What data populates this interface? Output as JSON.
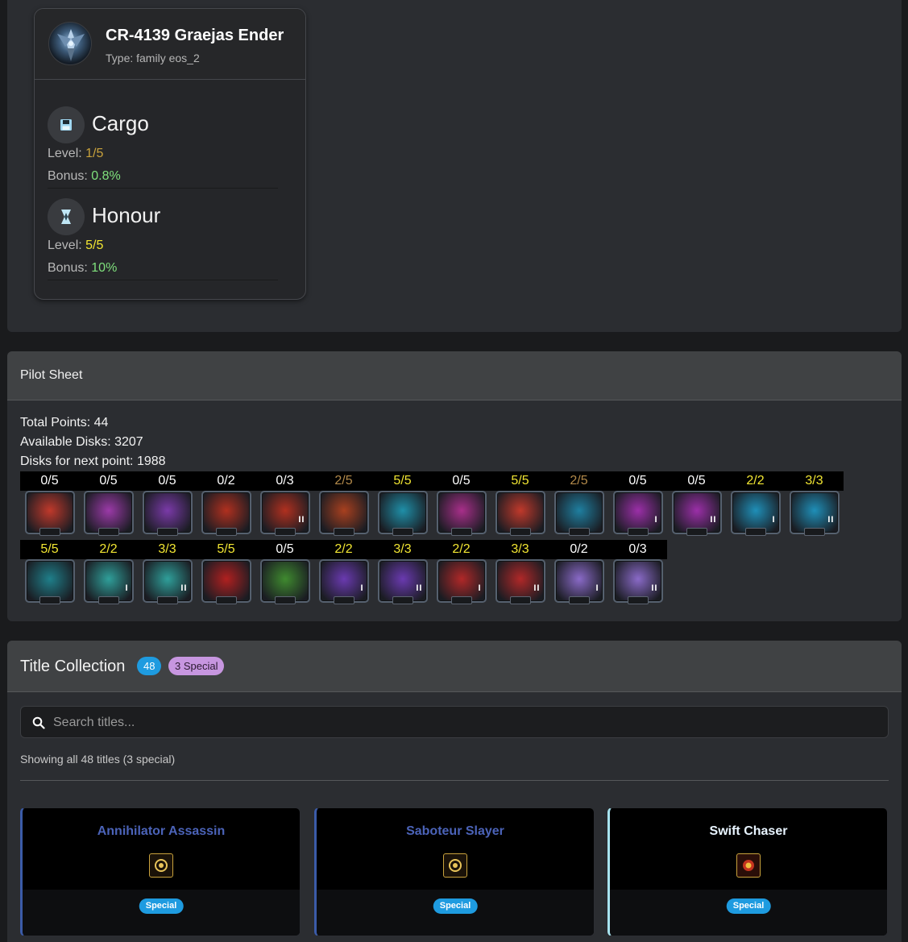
{
  "pet": {
    "name": "CR-4139 Graejas Ender",
    "type": "Type: family eos_2",
    "gears": [
      {
        "name": "Cargo",
        "level_label": "Level:",
        "level": "1/5",
        "bonus_label": "Bonus:",
        "bonus": "0.8%",
        "icon": "floppy-disk-icon"
      },
      {
        "name": "Honour",
        "level_label": "Level:",
        "level": "5/5",
        "bonus_label": "Bonus:",
        "bonus": "10%",
        "icon": "honour-badge-icon"
      }
    ]
  },
  "pilot_sheet": {
    "title": "Pilot Sheet",
    "total_points": "Total Points: 44",
    "available_disks": "Available Disks: 3207",
    "disks_next": "Disks for next point: 1988",
    "row1": [
      {
        "count": "0/5",
        "color": "#c0392b",
        "tier": ""
      },
      {
        "count": "0/5",
        "color": "#9b3aa8",
        "tier": ""
      },
      {
        "count": "0/5",
        "color": "#7a3aa8",
        "tier": ""
      },
      {
        "count": "0/2",
        "color": "#b0301f",
        "tier": ""
      },
      {
        "count": "0/3",
        "color": "#b0301f",
        "tier": "II"
      },
      {
        "count": "2/5",
        "color": "#a8401f",
        "tier": ""
      },
      {
        "count": "5/5",
        "color": "#1f8fa8",
        "tier": ""
      },
      {
        "count": "0/5",
        "color": "#a82f8a",
        "tier": ""
      },
      {
        "count": "5/5",
        "color": "#c0392b",
        "tier": ""
      },
      {
        "count": "2/5",
        "color": "#1f7fa0",
        "tier": ""
      },
      {
        "count": "0/5",
        "color": "#9b2fa8",
        "tier": "I"
      },
      {
        "count": "0/5",
        "color": "#9b2fa8",
        "tier": "II"
      },
      {
        "count": "2/2",
        "color": "#1f8fb8",
        "tier": "I"
      },
      {
        "count": "3/3",
        "color": "#1f8fb8",
        "tier": "II"
      }
    ],
    "row2": [
      {
        "count": "5/5",
        "color": "#1f7f8a",
        "tier": ""
      },
      {
        "count": "2/2",
        "color": "#2f9f9a",
        "tier": "I"
      },
      {
        "count": "3/3",
        "color": "#2f9f9a",
        "tier": "II"
      },
      {
        "count": "5/5",
        "color": "#b02020",
        "tier": ""
      },
      {
        "count": "0/5",
        "color": "#3f8a2f",
        "tier": ""
      },
      {
        "count": "2/2",
        "color": "#6a3ab0",
        "tier": "I"
      },
      {
        "count": "3/3",
        "color": "#6a3ab0",
        "tier": "II"
      },
      {
        "count": "2/2",
        "color": "#b02828",
        "tier": "I"
      },
      {
        "count": "3/3",
        "color": "#b02828",
        "tier": "II"
      },
      {
        "count": "0/2",
        "color": "#8a6ac8",
        "tier": "I"
      },
      {
        "count": "0/3",
        "color": "#8a6ac8",
        "tier": "II"
      }
    ]
  },
  "titles": {
    "heading": "Title Collection",
    "count": "48",
    "special": "3 Special",
    "search_placeholder": "Search titles...",
    "showing": "Showing all 48 titles (3 special)",
    "cards": [
      {
        "name": "Annihilator Assassin",
        "pill": "Special",
        "name_color": "#4b63b8",
        "accent": "#3b5ba8"
      },
      {
        "name": "Saboteur Slayer",
        "pill": "Special",
        "name_color": "#4b63b8",
        "accent": "#3b5ba8"
      },
      {
        "name": "Swift Chaser",
        "pill": "Special",
        "name_color": "#e8f4ff",
        "accent": "#a8e4f0"
      }
    ]
  }
}
